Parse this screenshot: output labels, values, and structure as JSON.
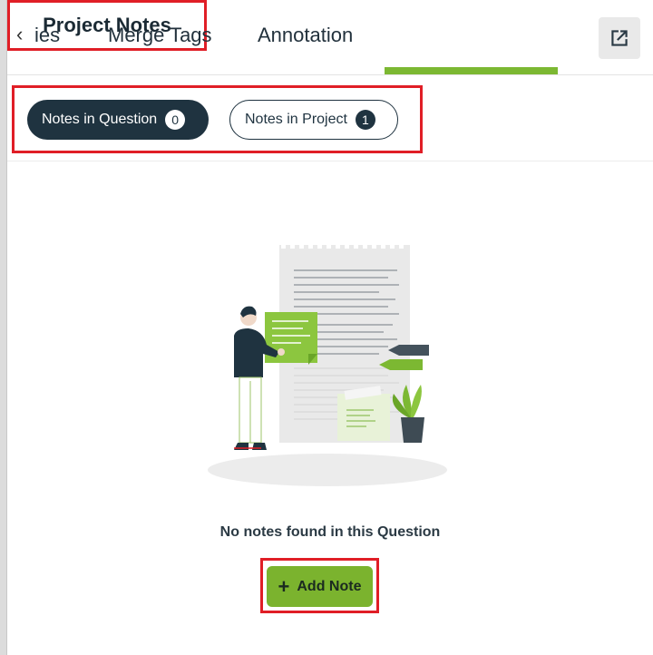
{
  "tabs": {
    "partial": "ies",
    "merge": "Merge Tags",
    "annotation": "Annotation",
    "active": "Project Notes"
  },
  "filters": {
    "question_label": "Notes in Question",
    "question_count": "0",
    "project_label": "Notes in Project",
    "project_count": "1"
  },
  "empty_state": {
    "message": "No notes found in this Question"
  },
  "actions": {
    "add_note": "Add Note"
  },
  "colors": {
    "accent_green": "#7cb832",
    "dark_navy": "#1f3340",
    "highlight_red": "#e01e26"
  }
}
